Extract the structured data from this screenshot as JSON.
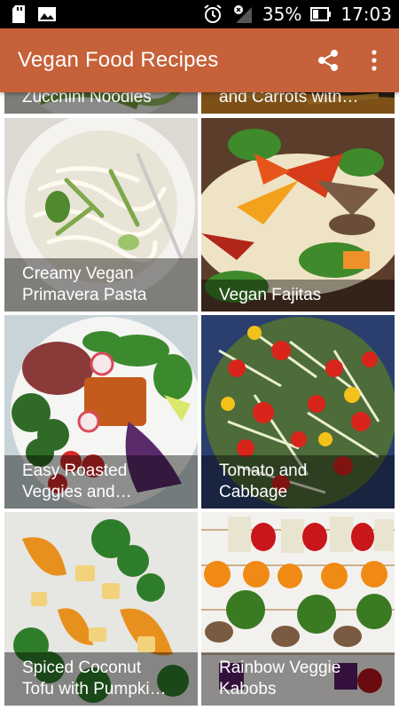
{
  "status_bar": {
    "battery": "35%",
    "time": "17:03",
    "icons": [
      "sd-card-icon",
      "image-icon",
      "alarm-icon",
      "signal-off-icon",
      "battery-icon"
    ]
  },
  "app_bar": {
    "title": "Vegan Food Recipes",
    "actions": [
      "share-icon",
      "more-vert-icon"
    ]
  },
  "colors": {
    "app_bar": "#c6613a",
    "caption_overlay": "rgba(0,0,0,0.42)"
  },
  "recipes": [
    {
      "line1": "Zucchini Noodles",
      "line2": ""
    },
    {
      "line1": "and Carrots with…",
      "line2": ""
    },
    {
      "line1": "Creamy Vegan",
      "line2": "Primavera Pasta"
    },
    {
      "line1": "Vegan Fajitas",
      "line2": ""
    },
    {
      "line1": "Easy Roasted",
      "line2": "Veggies and…"
    },
    {
      "line1": "Tomato and",
      "line2": "Cabbage"
    },
    {
      "line1": "Spiced Coconut",
      "line2": "Tofu with Pumpki…"
    },
    {
      "line1": "Rainbow Veggie",
      "line2": "Kabobs"
    }
  ]
}
